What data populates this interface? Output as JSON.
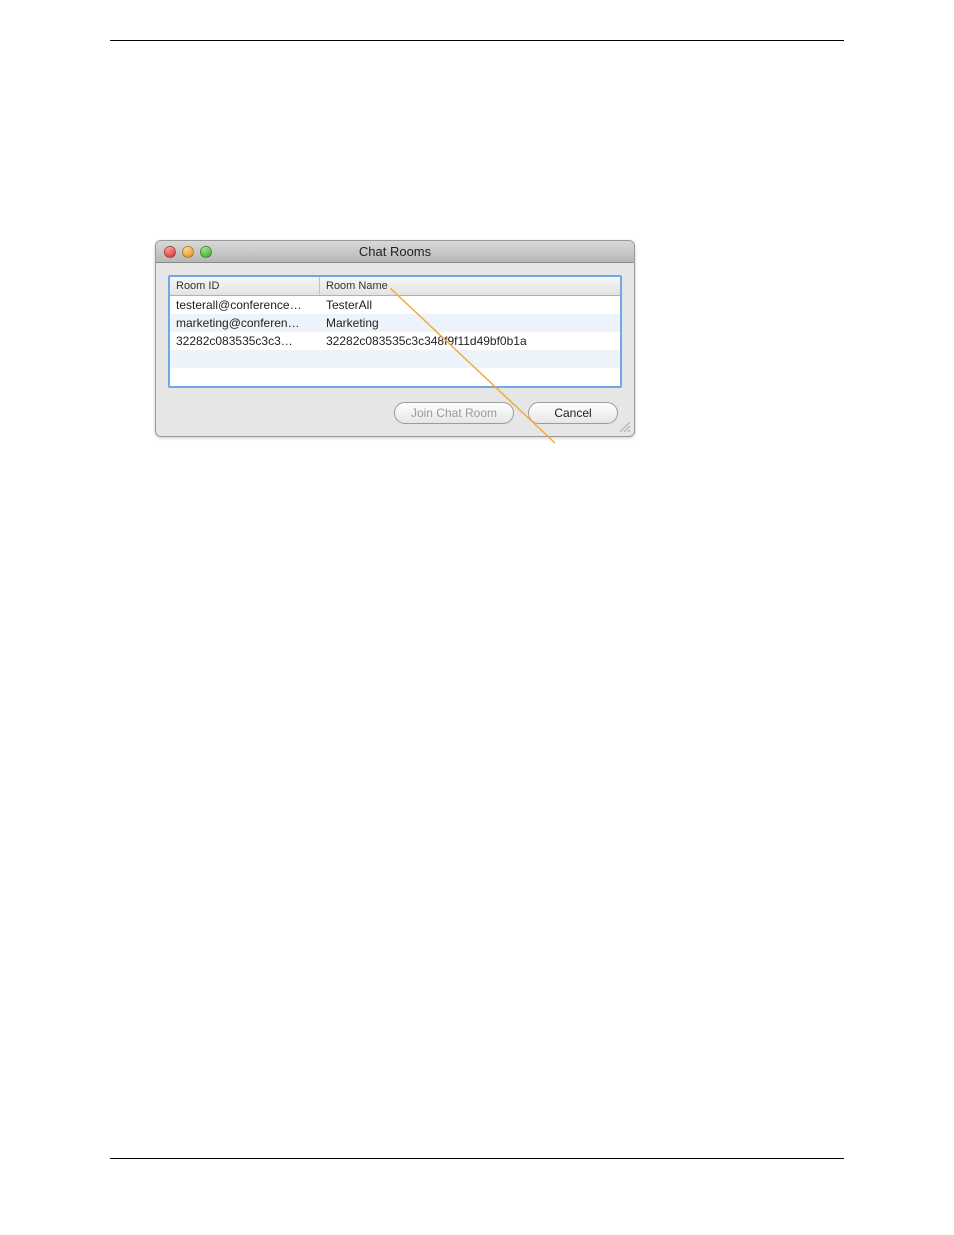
{
  "window": {
    "title": "Chat Rooms",
    "traffic_light_names": {
      "close": "close-icon",
      "min": "minimize-icon",
      "zoom": "zoom-icon"
    }
  },
  "table": {
    "headers": {
      "id": "Room ID",
      "name": "Room Name"
    },
    "rows": [
      {
        "id": "testerall@conference…",
        "name": "TesterAll"
      },
      {
        "id": "marketing@conferen…",
        "name": "Marketing"
      },
      {
        "id": "32282c083535c3c3…",
        "name": "32282c083535c3c348f9f11d49bf0b1a"
      },
      {
        "id": "",
        "name": ""
      },
      {
        "id": "",
        "name": ""
      }
    ]
  },
  "buttons": {
    "join": "Join Chat Room",
    "cancel": "Cancel"
  }
}
